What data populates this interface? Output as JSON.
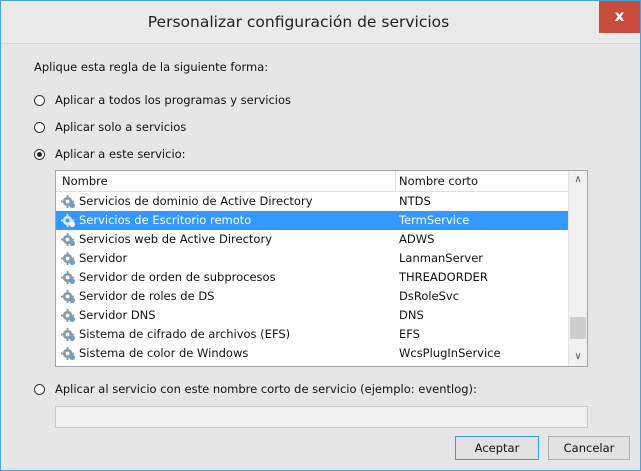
{
  "window": {
    "title": "Personalizar configuración de servicios",
    "close_glyph": "x"
  },
  "intro_label": "Aplique esta regla de la siguiente forma:",
  "options": [
    {
      "label": "Aplicar a todos los programas y servicios",
      "selected": false
    },
    {
      "label": "Aplicar solo a servicios",
      "selected": false
    },
    {
      "label": "Aplicar a este servicio:",
      "selected": true
    },
    {
      "label": "Aplicar al servicio con este nombre corto de servicio (ejemplo: eventlog):",
      "selected": false
    }
  ],
  "service_list": {
    "columns": {
      "name": "Nombre",
      "short": "Nombre corto"
    },
    "rows": [
      {
        "name": "Servicios de dominio de Active Directory",
        "short": "NTDS",
        "selected": false
      },
      {
        "name": "Servicios de Escritorio remoto",
        "short": "TermService",
        "selected": true
      },
      {
        "name": "Servicios web de Active Directory",
        "short": "ADWS",
        "selected": false
      },
      {
        "name": "Servidor",
        "short": "LanmanServer",
        "selected": false
      },
      {
        "name": "Servidor de orden de subprocesos",
        "short": "THREADORDER",
        "selected": false
      },
      {
        "name": "Servidor de roles de DS",
        "short": "DsRoleSvc",
        "selected": false
      },
      {
        "name": "Servidor DNS",
        "short": "DNS",
        "selected": false
      },
      {
        "name": "Sistema de cifrado de archivos (EFS)",
        "short": "EFS",
        "selected": false
      },
      {
        "name": "Sistema de color de Windows",
        "short": "WcsPlugInService",
        "selected": false
      }
    ],
    "row_icon": "gear-service-icon",
    "selection_color": "#3399ff"
  },
  "short_name_input": {
    "value": ""
  },
  "buttons": {
    "ok": "Aceptar",
    "cancel": "Cancelar"
  },
  "colors": {
    "title_close": "#c94b3b",
    "window_border": "#4ea2d6"
  }
}
